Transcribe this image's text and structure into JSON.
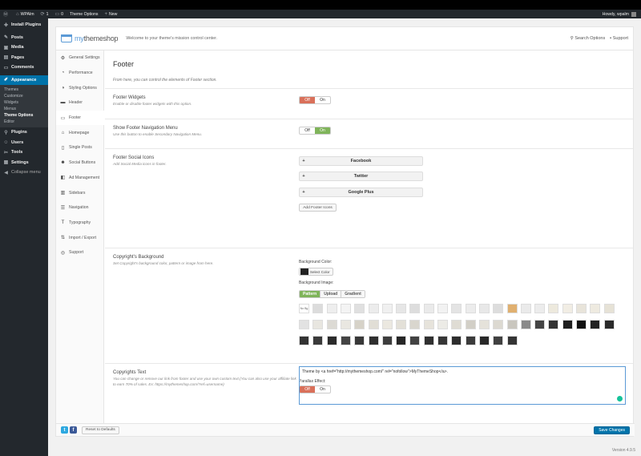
{
  "adminbar": {
    "site_name": "WPAlm",
    "updates": "1",
    "comments": "0",
    "theme_options": "Theme Options",
    "new": "New",
    "howdy": "Howdy, wpalm"
  },
  "wpmenu": {
    "install_plugins": "Install Plugins",
    "posts": "Posts",
    "media": "Media",
    "pages": "Pages",
    "comments": "Comments",
    "appearance": "Appearance",
    "submenu": [
      "Themes",
      "Customize",
      "Widgets",
      "Menus",
      "Theme Options",
      "Editor"
    ],
    "plugins": "Plugins",
    "users": "Users",
    "tools": "Tools",
    "settings": "Settings",
    "collapse": "Collapse menu"
  },
  "header": {
    "logo_part1": "my",
    "logo_part2": "theme",
    "logo_part3": "shop",
    "tagline": "Welcome to your theme's mission control center.",
    "search_options": "Search Options",
    "support": "Support"
  },
  "tabs": [
    {
      "label": "General Settings",
      "icon": "gear-icon"
    },
    {
      "label": "Performance",
      "icon": "gauge-icon"
    },
    {
      "label": "Styling Options",
      "icon": "contrast-icon"
    },
    {
      "label": "Header",
      "icon": "header-icon"
    },
    {
      "label": "Footer",
      "icon": "footer-icon"
    },
    {
      "label": "Homepage",
      "icon": "home-icon"
    },
    {
      "label": "Single Posts",
      "icon": "document-icon"
    },
    {
      "label": "Social Buttons",
      "icon": "people-icon"
    },
    {
      "label": "Ad Management",
      "icon": "ad-icon"
    },
    {
      "label": "Sidebars",
      "icon": "sidebar-icon"
    },
    {
      "label": "Navigation",
      "icon": "menu-icon"
    },
    {
      "label": "Typography",
      "icon": "text-icon"
    },
    {
      "label": "Import / Export",
      "icon": "transfer-icon"
    },
    {
      "label": "Support",
      "icon": "lifebuoy-icon"
    }
  ],
  "footer_section": {
    "title": "Footer",
    "desc": "From here, you can control the elements of Footer section.",
    "widgets_title": "Footer Widgets",
    "widgets_desc": "Enable or disable footer widgets with this option.",
    "nav_title": "Show Footer Navigation Menu",
    "nav_desc": "Use this button to enable Secondary Navigation Menu.",
    "social_title": "Footer Social Icons",
    "social_desc": "Add Social Media icons in footer.",
    "social_items": [
      "Facebook",
      "Twitter",
      "Google Plus"
    ],
    "add_icons": "Add Footer Icons",
    "bg_title": "Copyright's Background",
    "bg_desc": "Set Copyright's background color, pattern or image from here.",
    "bg_color_label": "Background Color:",
    "select_color": "Select Color",
    "bg_image_label": "Background Image:",
    "bg_options": [
      "Pattern",
      "Upload",
      "Gradient"
    ],
    "no_bg": "No Bg",
    "parallax_label": "Parallax Effect:",
    "copy_title": "Copyrights Text",
    "copy_desc": "You can change or remove our link from footer and use your own custom text.(You can also use your affiliate link to earn 70% of sales. Ex: https://mythemeshop.com/?ref=username)",
    "copy_value": "Theme by <a href=\"http://mythemeshop.com/\" rel=\"nofollow\">MyThemeShop</a>."
  },
  "toggle": {
    "off": "Off",
    "on": "On"
  },
  "footer": {
    "reset": "Reset to Defaults",
    "save": "Save Changes"
  },
  "version": "Version 4.9.5"
}
